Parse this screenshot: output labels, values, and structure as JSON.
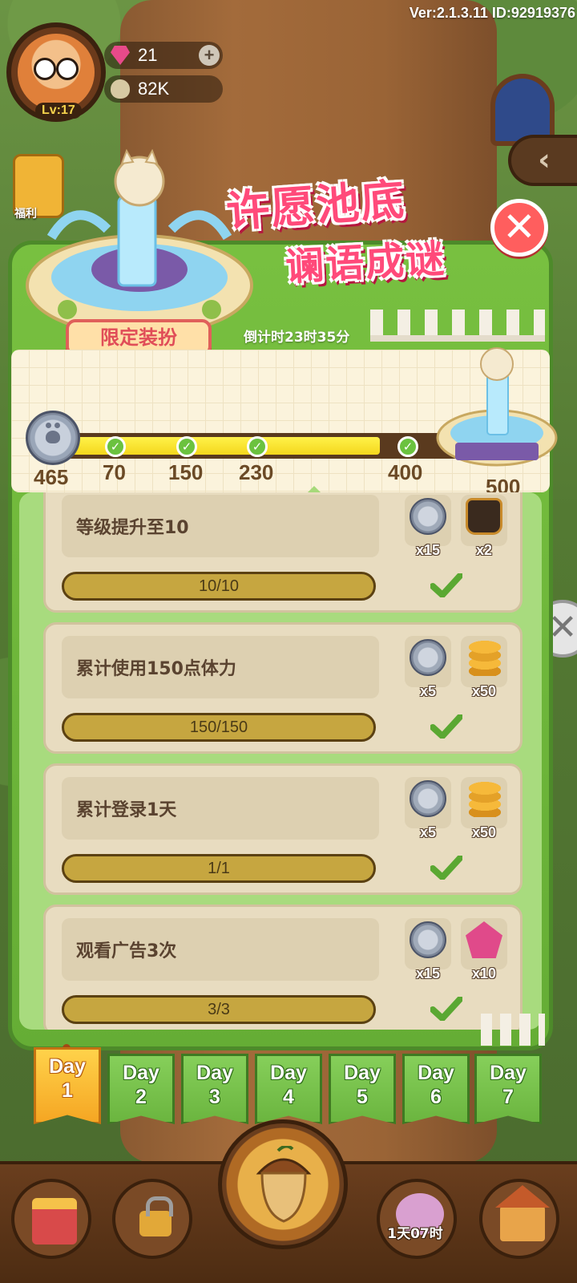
{
  "header": {
    "version_text": "Ver:2.1.3.11 ID:92919376",
    "player": {
      "level": "Lv:17"
    },
    "resources": [
      {
        "icon": "gem-icon",
        "value": "21"
      },
      {
        "icon": "seed-icon",
        "value": "82K"
      }
    ],
    "left_icon_label": "福利"
  },
  "event": {
    "title_line1": "许愿池底",
    "title_line2": "谰语成谜",
    "limited_badge": "限定装扮",
    "countdown": "倒计时23时35分",
    "accent_color": "#ff4a7a"
  },
  "progress": {
    "current": "465",
    "fill_fraction": 0.8,
    "milestones": [
      {
        "label": "70",
        "claimed": true
      },
      {
        "label": "150",
        "claimed": true
      },
      {
        "label": "230",
        "claimed": true
      },
      {
        "label": "400",
        "claimed": true
      },
      {
        "label": "500",
        "claimed": false
      }
    ]
  },
  "tasks": [
    {
      "title": "等级提升至10",
      "progress": "10/10",
      "completed": true,
      "rewards": [
        {
          "icon": "paw-coin-icon",
          "qty": "x15"
        },
        {
          "icon": "bag-icon",
          "qty": "x2"
        }
      ]
    },
    {
      "title": "累计使用150点体力",
      "progress": "150/150",
      "completed": true,
      "rewards": [
        {
          "icon": "paw-coin-icon",
          "qty": "x5"
        },
        {
          "icon": "gold-coins-icon",
          "qty": "x50"
        }
      ]
    },
    {
      "title": "累计登录1天",
      "progress": "1/1",
      "completed": true,
      "rewards": [
        {
          "icon": "paw-coin-icon",
          "qty": "x5"
        },
        {
          "icon": "gold-coins-icon",
          "qty": "x50"
        }
      ]
    },
    {
      "title": "观看广告3次",
      "progress": "3/3",
      "completed": true,
      "rewards": [
        {
          "icon": "paw-coin-icon",
          "qty": "x15"
        },
        {
          "icon": "gem-pile-icon",
          "qty": "x10"
        }
      ]
    }
  ],
  "day_tabs": [
    {
      "line1": "Day",
      "line2": "1",
      "active": true
    },
    {
      "line1": "Day",
      "line2": "2",
      "active": false
    },
    {
      "line1": "Day",
      "line2": "3",
      "active": false
    },
    {
      "line1": "Day",
      "line2": "4",
      "active": false
    },
    {
      "line1": "Day",
      "line2": "5",
      "active": false
    },
    {
      "line1": "Day",
      "line2": "6",
      "active": false
    },
    {
      "line1": "Day",
      "line2": "7",
      "active": false
    }
  ],
  "bottom_nav": {
    "timer_label": "1天07时"
  }
}
